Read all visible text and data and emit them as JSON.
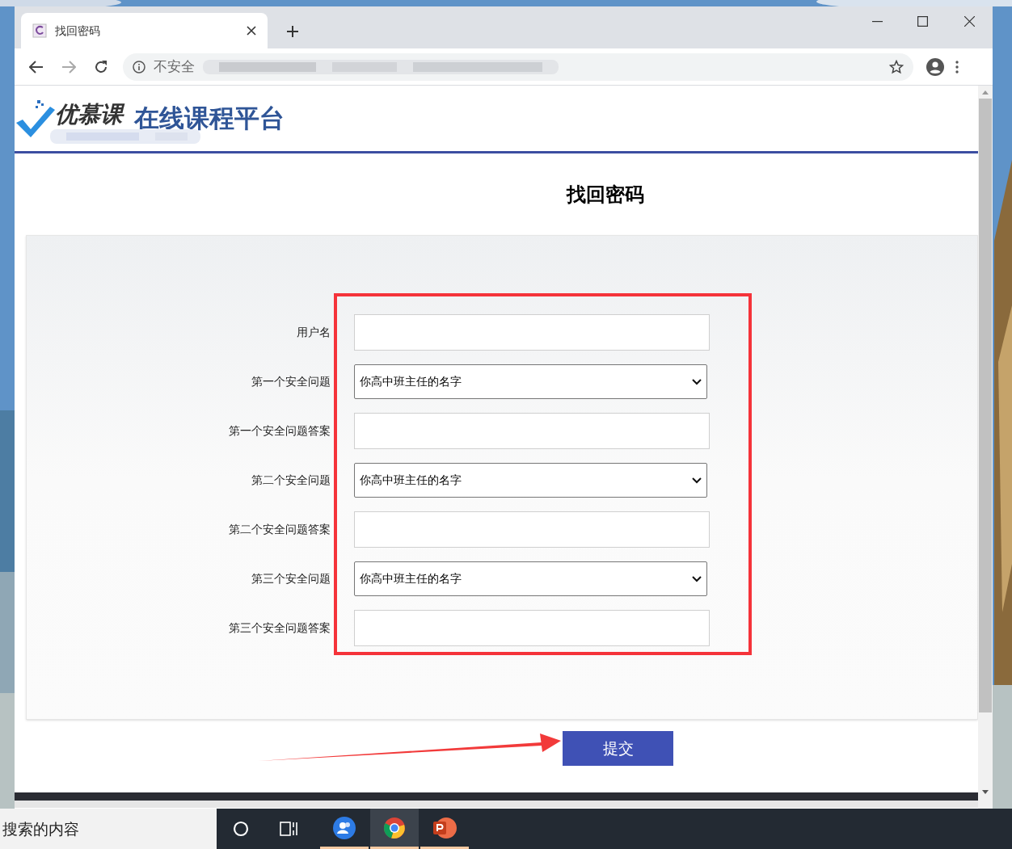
{
  "browser": {
    "tab_title": "找回密码",
    "security_label": "不安全"
  },
  "header": {
    "logo_brand": "优慕课",
    "platform_name": "在线课程平台"
  },
  "page_title": "找回密码",
  "form": {
    "fields": [
      {
        "kind": "text",
        "label": "用户名"
      },
      {
        "kind": "select",
        "label": "第一个安全问题",
        "value": "你高中班主任的名字"
      },
      {
        "kind": "text",
        "label": "第一个安全问题答案"
      },
      {
        "kind": "select",
        "label": "第二个安全问题",
        "value": "你高中班主任的名字"
      },
      {
        "kind": "text",
        "label": "第二个安全问题答案"
      },
      {
        "kind": "select",
        "label": "第三个安全问题",
        "value": "你高中班主任的名字"
      },
      {
        "kind": "text",
        "label": "第三个安全问题答案"
      }
    ],
    "submit_label": "提交"
  },
  "taskbar": {
    "search_text": "搜索的内容",
    "apps": [
      {
        "kind": "people",
        "selected": false
      },
      {
        "kind": "browser",
        "selected": true
      },
      {
        "kind": "slides",
        "selected": false
      }
    ]
  }
}
